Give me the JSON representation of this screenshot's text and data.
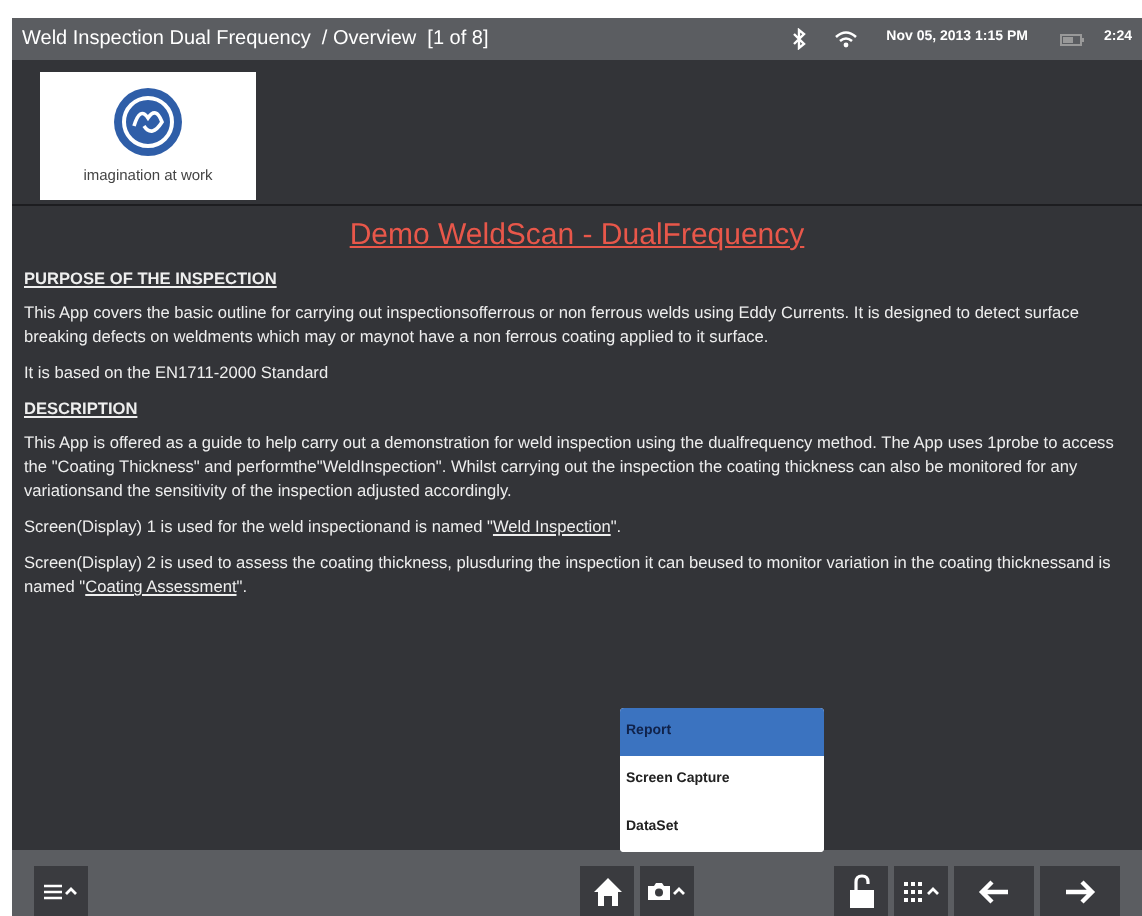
{
  "title_bar": {
    "title": "Weld Inspection Dual Frequency  / Overview  [1 of 8]",
    "datetime": "Nov 05, 2013 1:15 PM",
    "battery_time": "2:24"
  },
  "logo": {
    "tagline": "imagination at work"
  },
  "heading": "Demo WeldScan - DualFrequency",
  "sections": [
    {
      "kind": "heading",
      "text": "PURPOSE OF THE INSPECTION"
    },
    {
      "kind": "paragraph",
      "text": "This App covers the basic outline for carrying out inspectionsofferrous or non ferrous welds using Eddy Currents. It is designed to detect surface breaking defects on weldments which may or maynot have a non ferrous coating applied to it surface."
    },
    {
      "kind": "paragraph",
      "text": "It is based on the EN1711-2000 Standard"
    },
    {
      "kind": "heading",
      "text": "DESCRIPTION"
    },
    {
      "kind": "paragraph",
      "text": "This App is offered as a guide to help carry out a demonstration for weld inspection using the dualfrequency method. The App uses 1probe to access the \"Coating Thickness\" and performthe\"WeldInspection\". Whilst carrying out the inspection the coating thickness can also be monitored for any variationsand the sensitivity of the inspection adjusted accordingly."
    },
    {
      "kind": "link_paragraph",
      "before": "Screen(Display) 1 is used for the weld inspectionand is named \"",
      "link": "Weld Inspection",
      "after": "\"."
    },
    {
      "kind": "link_paragraph",
      "before": "Screen(Display) 2 is used to assess the coating thickness, plusduring the inspection it can beused to monitor variation in the coating thicknessand is named \"",
      "link": "Coating Assessment",
      "after": "\"."
    }
  ],
  "capture_menu": [
    {
      "label": "Report",
      "selected": true
    },
    {
      "label": "Screen Capture",
      "selected": false
    },
    {
      "label": "DataSet",
      "selected": false
    }
  ]
}
